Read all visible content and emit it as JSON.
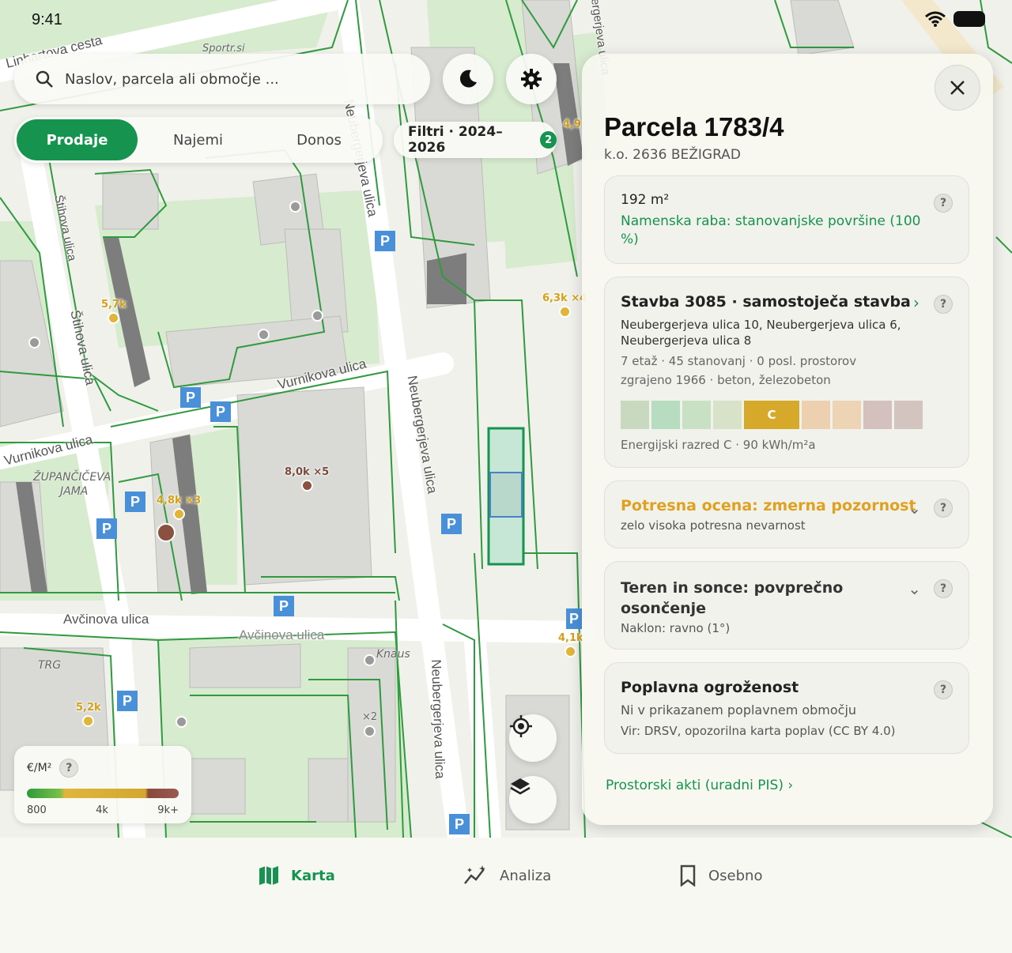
{
  "status": {
    "time": "9:41"
  },
  "search": {
    "placeholder": "Naslov, parcela ali območje ..."
  },
  "top_buttons": [
    {
      "icon": "moon-icon"
    },
    {
      "icon": "gear-icon"
    }
  ],
  "segments": {
    "items": [
      "Prodaje",
      "Najemi",
      "Donos"
    ],
    "active": 0
  },
  "filters": {
    "label": "Filtri · 2024–2026",
    "count": "2"
  },
  "map": {
    "streets": [
      "Linhartova cesta",
      "Štihova ulica",
      "Vurnikova ulica",
      "Vurnikova ulica",
      "Neubergerjeva ulica",
      "Avčinova ulica",
      "Avčinova ulica",
      "Neubergerjeva ulica",
      "Neubergerjeva ulica",
      "Neubergerjeva ulica",
      "Štihova ulica"
    ],
    "places": [
      "ŽUPANČIČEVA",
      "JAMA",
      "TRG",
      "Knaus",
      "Sportr.si"
    ],
    "price_pins": [
      "5,7k",
      "6,3k ×4",
      "4,8k ×3",
      "8,0k ×5",
      "5,2k",
      "4,1k",
      "4,9"
    ],
    "count_label": "×2"
  },
  "legend": {
    "title": "€/M²",
    "ticks": [
      "800",
      "4k",
      "9k+"
    ]
  },
  "panel": {
    "title": "Parcela 1783/4",
    "subtitle": "k.o. 2636 BEŽIGRAD",
    "area": {
      "size": "192 m²",
      "use": "Namenska raba: stanovanjske površine (100 %)"
    },
    "building": {
      "title": "Stavba 3085 · samostoječa stavba",
      "address": "Neubergerjeva ulica 10, Neubergerjeva ulica 6, Neubergerjeva ulica 8",
      "stats": "7 etaž · 45 stanovanj · 0 posl. prostorov",
      "built": "zgrajeno 1966 · beton, železobeton",
      "energy_class": "C",
      "energy_label": "Energijski razred C · 90 kWh/m²a",
      "energy_colors": [
        "#c8d9c0",
        "#b8dcc0",
        "#c8e0c4",
        "#d8e2c8",
        "#d6a92a",
        "#ecd0b0",
        "#ecd4b4",
        "#d4c0bc",
        "#d4c4c0"
      ]
    },
    "seismic": {
      "title": "Potresna ocena: zmerna pozornost",
      "desc": "zelo visoka potresna nevarnost"
    },
    "terrain": {
      "title": "Teren in sonce: povprečno osončenje",
      "desc": "Naklon: ravno (1°)"
    },
    "flood": {
      "title": "Poplavna ogroženost",
      "desc": "Ni v prikazanem poplavnem območju",
      "source": "Vir: DRSV, opozorilna karta poplav (CC BY 4.0)"
    },
    "link": "Prostorski akti (uradni PIS) ›"
  },
  "nav": {
    "items": [
      "Karta",
      "Analiza",
      "Osebno"
    ],
    "active": 0
  }
}
